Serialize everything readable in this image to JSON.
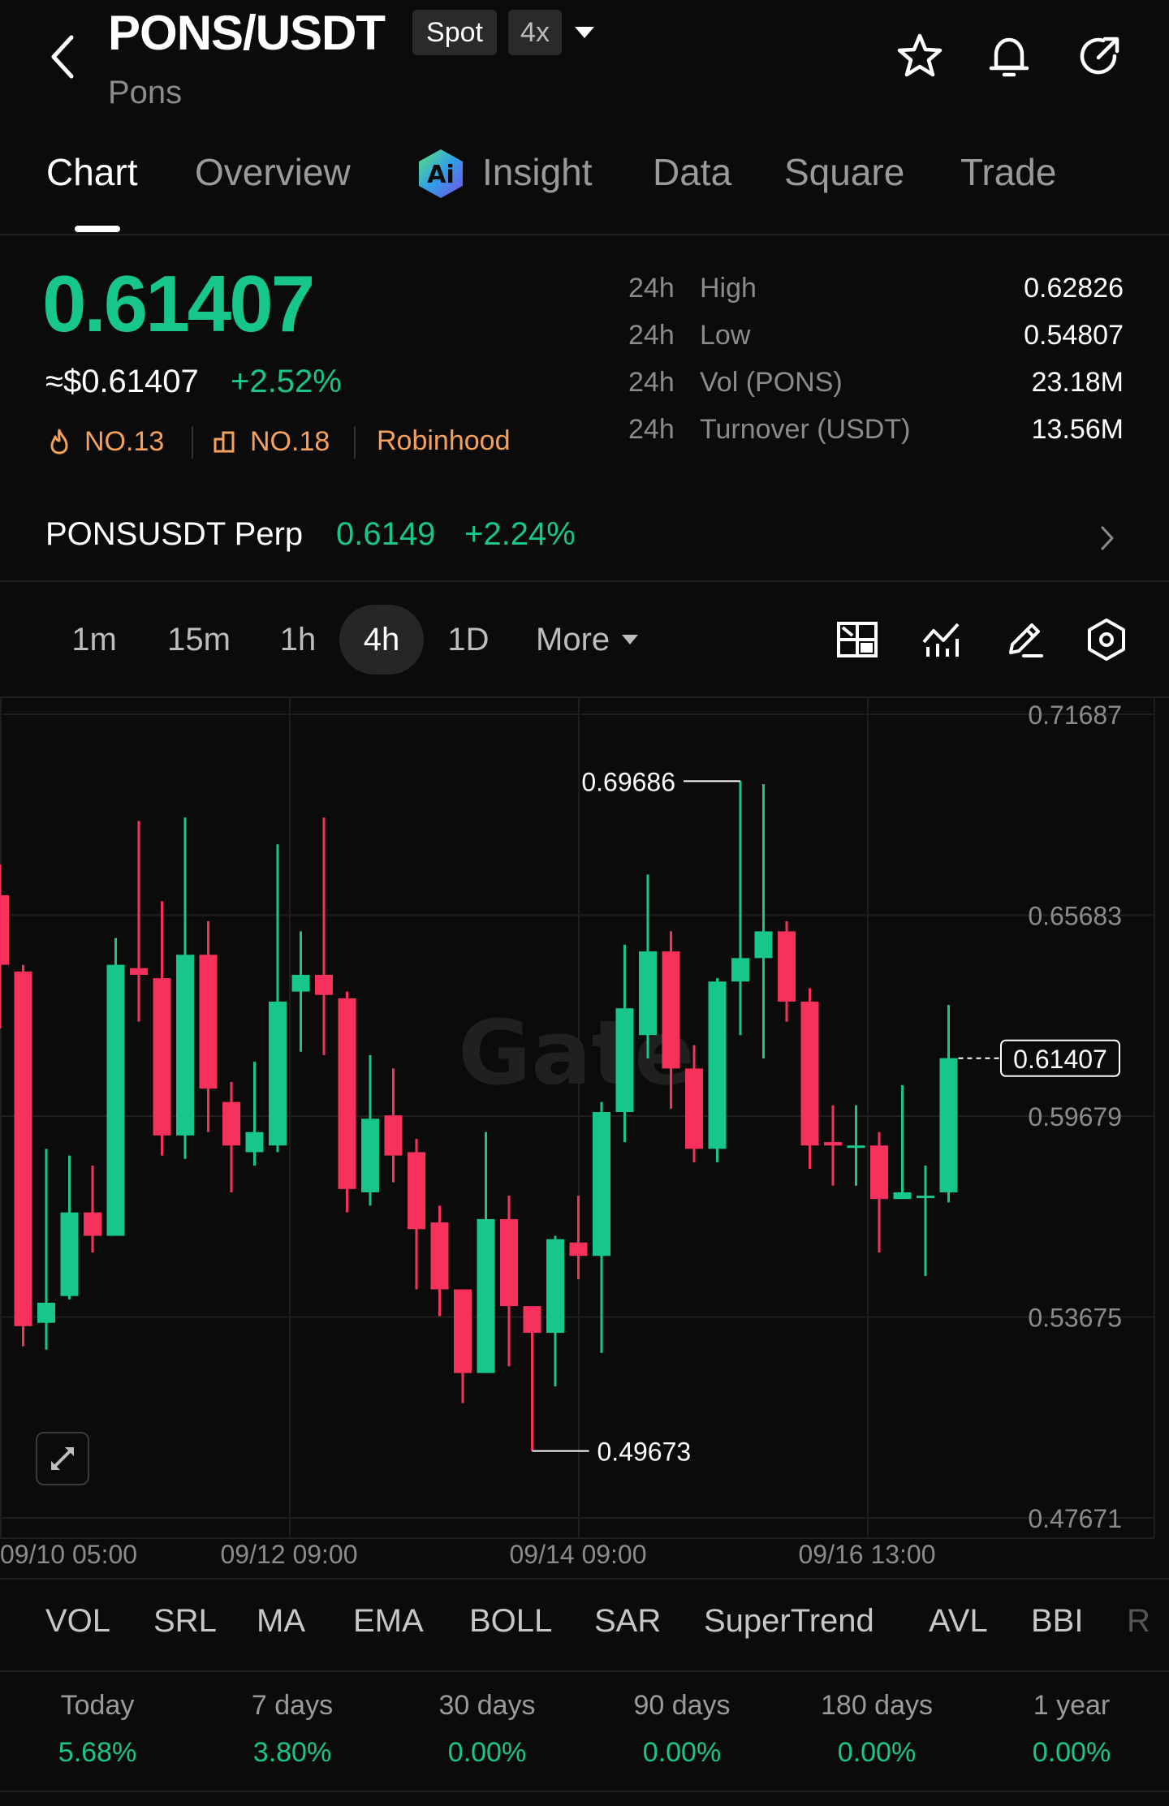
{
  "header": {
    "pair": "PONS/USDT",
    "subtitle": "Pons",
    "spot_badge": "Spot",
    "leverage_badge": "4x"
  },
  "tabs": [
    {
      "label": "Chart",
      "active": true
    },
    {
      "label": "Overview",
      "active": false
    },
    {
      "label": "Insight",
      "active": false
    },
    {
      "label": "Data",
      "active": false
    },
    {
      "label": "Square",
      "active": false
    },
    {
      "label": "Trade",
      "active": false
    }
  ],
  "price": {
    "last": "0.61407",
    "usd": "≈$0.61407",
    "change": "+2.52%",
    "rank_hot": "NO.13",
    "rank_gain": "NO.18",
    "tag": "Robinhood"
  },
  "stats": [
    {
      "period": "24h",
      "label": "High",
      "value": "0.62826"
    },
    {
      "period": "24h",
      "label": "Low",
      "value": "0.54807"
    },
    {
      "period": "24h",
      "label": "Vol (PONS)",
      "value": "23.18M"
    },
    {
      "period": "24h",
      "label": "Turnover (USDT)",
      "value": "13.56M"
    }
  ],
  "perp": {
    "name": "PONSUSDT Perp",
    "price": "0.6149",
    "change": "+2.24%"
  },
  "timeframes": [
    {
      "label": "1m",
      "active": false
    },
    {
      "label": "15m",
      "active": false
    },
    {
      "label": "1h",
      "active": false
    },
    {
      "label": "4h",
      "active": true
    },
    {
      "label": "1D",
      "active": false
    }
  ],
  "more_label": "More",
  "watermark": "Gate",
  "chart_data": {
    "type": "candlestick",
    "y_ticks": [
      "0.71687",
      "0.65683",
      "0.59679",
      "0.53675",
      "0.47671"
    ],
    "ylim": [
      0.47671,
      0.71687
    ],
    "x_ticks": [
      "09/10 05:00",
      "09/12 09:00",
      "09/14 09:00",
      "09/16 13:00"
    ],
    "high_label": "0.69686",
    "low_label": "0.49673",
    "current_label": "0.61407",
    "candles": [
      {
        "o": 0.6628,
        "h": 0.672,
        "l": 0.623,
        "c": 0.642
      },
      {
        "o": 0.64,
        "h": 0.642,
        "l": 0.528,
        "c": 0.534
      },
      {
        "o": 0.535,
        "h": 0.587,
        "l": 0.527,
        "c": 0.541
      },
      {
        "o": 0.543,
        "h": 0.585,
        "l": 0.542,
        "c": 0.568
      },
      {
        "o": 0.568,
        "h": 0.582,
        "l": 0.556,
        "c": 0.561
      },
      {
        "o": 0.561,
        "h": 0.65,
        "l": 0.561,
        "c": 0.642
      },
      {
        "o": 0.641,
        "h": 0.685,
        "l": 0.625,
        "c": 0.639
      },
      {
        "o": 0.638,
        "h": 0.661,
        "l": 0.585,
        "c": 0.591
      },
      {
        "o": 0.591,
        "h": 0.686,
        "l": 0.584,
        "c": 0.645
      },
      {
        "o": 0.645,
        "h": 0.655,
        "l": 0.592,
        "c": 0.605
      },
      {
        "o": 0.601,
        "h": 0.607,
        "l": 0.574,
        "c": 0.588
      },
      {
        "o": 0.586,
        "h": 0.613,
        "l": 0.582,
        "c": 0.592
      },
      {
        "o": 0.588,
        "h": 0.678,
        "l": 0.586,
        "c": 0.631
      },
      {
        "o": 0.634,
        "h": 0.652,
        "l": 0.616,
        "c": 0.639
      },
      {
        "o": 0.639,
        "h": 0.686,
        "l": 0.615,
        "c": 0.633
      },
      {
        "o": 0.632,
        "h": 0.634,
        "l": 0.568,
        "c": 0.575
      },
      {
        "o": 0.574,
        "h": 0.615,
        "l": 0.57,
        "c": 0.596
      },
      {
        "o": 0.597,
        "h": 0.611,
        "l": 0.577,
        "c": 0.585
      },
      {
        "o": 0.586,
        "h": 0.59,
        "l": 0.545,
        "c": 0.563
      },
      {
        "o": 0.565,
        "h": 0.57,
        "l": 0.537,
        "c": 0.545
      },
      {
        "o": 0.545,
        "h": 0.545,
        "l": 0.511,
        "c": 0.52
      },
      {
        "o": 0.52,
        "h": 0.592,
        "l": 0.52,
        "c": 0.566
      },
      {
        "o": 0.566,
        "h": 0.573,
        "l": 0.522,
        "c": 0.54
      },
      {
        "o": 0.54,
        "h": 0.54,
        "l": 0.4967,
        "c": 0.532
      },
      {
        "o": 0.532,
        "h": 0.561,
        "l": 0.516,
        "c": 0.56
      },
      {
        "o": 0.559,
        "h": 0.573,
        "l": 0.548,
        "c": 0.555
      },
      {
        "o": 0.555,
        "h": 0.601,
        "l": 0.526,
        "c": 0.598
      },
      {
        "o": 0.598,
        "h": 0.648,
        "l": 0.589,
        "c": 0.629
      },
      {
        "o": 0.621,
        "h": 0.669,
        "l": 0.614,
        "c": 0.646
      },
      {
        "o": 0.646,
        "h": 0.652,
        "l": 0.599,
        "c": 0.611
      },
      {
        "o": 0.611,
        "h": 0.618,
        "l": 0.583,
        "c": 0.587
      },
      {
        "o": 0.587,
        "h": 0.638,
        "l": 0.583,
        "c": 0.637
      },
      {
        "o": 0.637,
        "h": 0.6969,
        "l": 0.621,
        "c": 0.644
      },
      {
        "o": 0.644,
        "h": 0.696,
        "l": 0.614,
        "c": 0.652
      },
      {
        "o": 0.652,
        "h": 0.655,
        "l": 0.625,
        "c": 0.631
      },
      {
        "o": 0.631,
        "h": 0.635,
        "l": 0.581,
        "c": 0.588
      },
      {
        "o": 0.589,
        "h": 0.6,
        "l": 0.576,
        "c": 0.588
      },
      {
        "o": 0.588,
        "h": 0.6,
        "l": 0.576,
        "c": 0.588
      },
      {
        "o": 0.588,
        "h": 0.592,
        "l": 0.556,
        "c": 0.572
      },
      {
        "o": 0.572,
        "h": 0.606,
        "l": 0.572,
        "c": 0.574
      },
      {
        "o": 0.573,
        "h": 0.582,
        "l": 0.549,
        "c": 0.573
      },
      {
        "o": 0.574,
        "h": 0.63,
        "l": 0.571,
        "c": 0.6141
      }
    ]
  },
  "indicators": [
    "VOL",
    "SRL",
    "MA",
    "EMA",
    "BOLL",
    "SAR",
    "SuperTrend",
    "AVL",
    "BBI",
    "R"
  ],
  "performance": [
    {
      "label": "Today",
      "value": "5.68%"
    },
    {
      "label": "7 days",
      "value": "3.80%"
    },
    {
      "label": "30 days",
      "value": "0.00%"
    },
    {
      "label": "90 days",
      "value": "0.00%"
    },
    {
      "label": "180 days",
      "value": "0.00%"
    },
    {
      "label": "1 year",
      "value": "0.00%"
    }
  ]
}
